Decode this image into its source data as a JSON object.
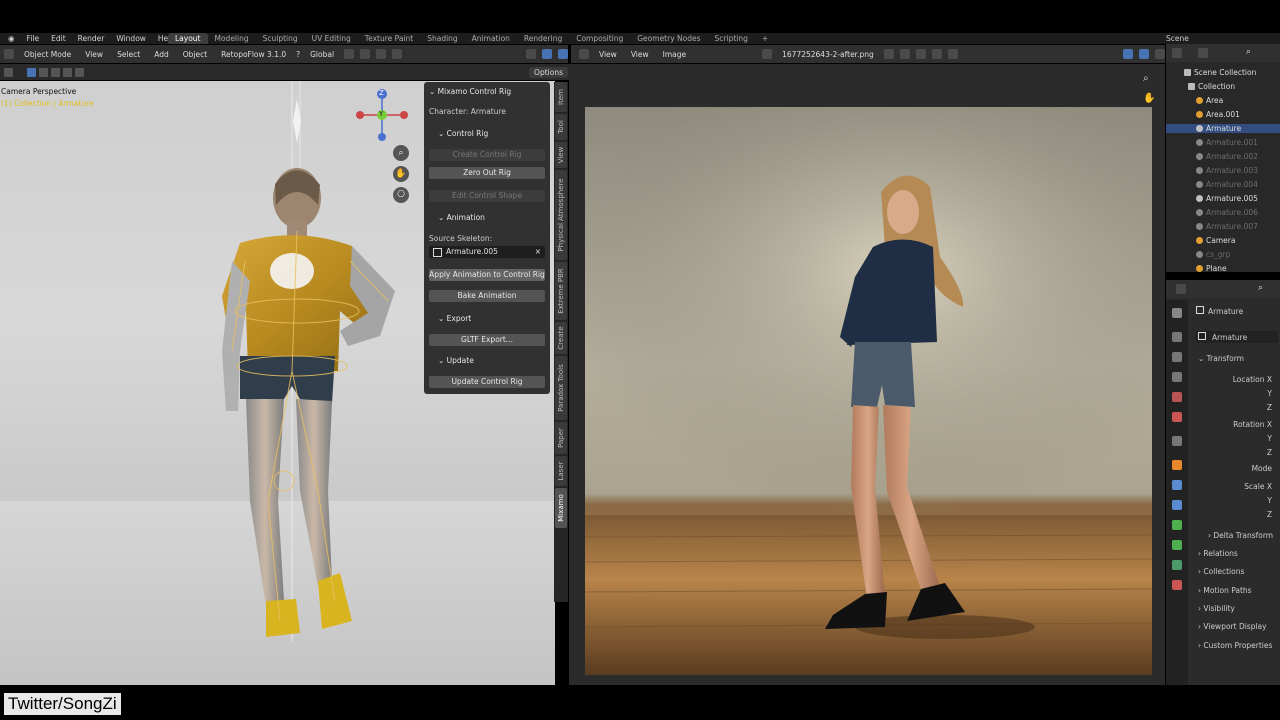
{
  "top_menu": [
    "File",
    "Edit",
    "Render",
    "Window",
    "Help"
  ],
  "workspace_tabs": [
    "Layout",
    "Modeling",
    "Sculpting",
    "UV Editing",
    "Texture Paint",
    "Shading",
    "Animation",
    "Rendering",
    "Compositing",
    "Geometry Nodes",
    "Scripting",
    "+"
  ],
  "active_workspace": "Layout",
  "scene_name": "Scene",
  "viewport_header": {
    "mode": "Object Mode",
    "menus": [
      "View",
      "Select",
      "Add",
      "Object"
    ],
    "addon": "RetopoFlow 3.1.0",
    "orientation": "Global",
    "options": "Options"
  },
  "viewport": {
    "label": "Camera Perspective",
    "sublabel": "(1) Collection | Armature",
    "gizmo_z": "Z",
    "gizmo_y": "Y"
  },
  "npanel": {
    "title": "Mixamo Control Rig",
    "character": "Character: Armature",
    "control_rig": "Control Rig",
    "create_control_rig": "Create Control Rig",
    "zero_out_rig": "Zero Out Rig",
    "edit_control_shape": "Edit Control Shape",
    "animation": "Animation",
    "source_skeleton": "Source Skeleton:",
    "source_value": "Armature.005",
    "apply_animation": "Apply Animation to Control Rig",
    "bake_animation": "Bake Animation",
    "export": "Export",
    "gltf_export": "GLTF Export...",
    "update": "Update",
    "update_control_rig": "Update Control Rig"
  },
  "vertical_tabs": [
    "Item",
    "Tool",
    "View",
    "Physical Atmosphere",
    "Extreme PBR",
    "Create",
    "Paradox Tools",
    "Paper",
    "Laser",
    "Mixamo"
  ],
  "active_vertical_tab": "Mixamo",
  "image_editor": {
    "menus": [
      "View",
      "View",
      "Image"
    ],
    "filename": "1677252643-2-after.png"
  },
  "outliner": {
    "root": "Scene Collection",
    "collection": "Collection",
    "items": [
      {
        "name": "Area",
        "dim": false,
        "color": "#e0a030"
      },
      {
        "name": "Area.001",
        "dim": false,
        "color": "#e0a030"
      },
      {
        "name": "Armature",
        "dim": false,
        "color": "#c0c0c0",
        "selected": true
      },
      {
        "name": "Armature.001",
        "dim": true,
        "color": "#888888"
      },
      {
        "name": "Armature.002",
        "dim": true,
        "color": "#888888"
      },
      {
        "name": "Armature.003",
        "dim": true,
        "color": "#888888"
      },
      {
        "name": "Armature.004",
        "dim": true,
        "color": "#888888"
      },
      {
        "name": "Armature.005",
        "dim": false,
        "color": "#c0c0c0"
      },
      {
        "name": "Armature.006",
        "dim": true,
        "color": "#888888"
      },
      {
        "name": "Armature.007",
        "dim": true,
        "color": "#888888"
      },
      {
        "name": "Camera",
        "dim": false,
        "color": "#e0a030"
      },
      {
        "name": "cs_grp",
        "dim": true,
        "color": "#888888"
      },
      {
        "name": "Plane",
        "dim": false,
        "color": "#e0a030"
      }
    ]
  },
  "properties": {
    "object_name": "Armature",
    "data_name": "Armature",
    "transform": "Transform",
    "location": "Location X",
    "rotation": "Rotation X",
    "mode": "Mode",
    "scale": "Scale X",
    "y": "Y",
    "z": "Z",
    "delta_transform": "Delta Transform",
    "relations": "Relations",
    "collections": "Collections",
    "motion_paths": "Motion Paths",
    "visibility": "Visibility",
    "viewport_display": "Viewport Display",
    "custom_properties": "Custom Properties"
  },
  "watermark": "Twitter/SongZi",
  "colors": {
    "accent": "#4772b3",
    "header": "#303030",
    "panel": "#282828"
  }
}
